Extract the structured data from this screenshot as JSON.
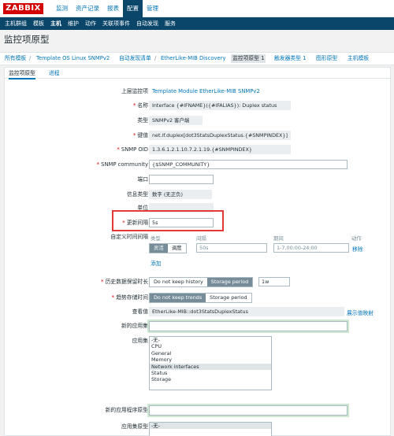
{
  "logo": "ZABBIX",
  "topnav": [
    "监测",
    "资产记录",
    "报表",
    "配置",
    "管理"
  ],
  "subnav": [
    "主机群组",
    "模板",
    "主机",
    "维护",
    "动作",
    "关联项事件",
    "自动发现",
    "服务"
  ],
  "page_title": "监控项原型",
  "breadcrumb": {
    "all_templates": "所有模板",
    "template": "Template OS Linux SNMPv2",
    "discovery_list": "自动发现清单",
    "discovery": "EtherLike-MIB Discovery",
    "item_prototypes": "监控项原型 1",
    "trigger_prototypes": "触发器类型 1",
    "graph_prototypes": "图形原型",
    "host_prototypes": "主机模板"
  },
  "tabs": {
    "item": "监控项原型",
    "process": "进程"
  },
  "form": {
    "parent_label": "上层监控项",
    "parent_value": "Template Module EtherLike-MIB SNMPv2",
    "name_label": "名称",
    "name_value": "Interface {#IFNAME}({#IFALIAS}): Duplex status",
    "type_label": "类型",
    "type_value": "SNMPv2 客户端",
    "key_label": "键值",
    "key_value": "net.if.duplex[dot3StatsDuplexStatus.{#SNMPINDEX}]",
    "oid_label": "SNMP OID",
    "oid_value": "1.3.6.1.2.1.10.7.2.1.19.{#SNMPINDEX}",
    "community_label": "SNMP community",
    "community_value": "{$SNMP_COMMUNITY}",
    "port_label": "端口",
    "port_value": "",
    "info_type_label": "信息类型",
    "info_type_value": "数字 (无正负)",
    "units_label": "单位",
    "units_value": "",
    "interval_label": "更新间隔",
    "interval_value": "5s",
    "custom_label": "自定义时间间隔",
    "custom_col_type": "类型",
    "custom_col_interval": "间隔",
    "custom_col_period": "期间",
    "custom_col_action": "动作",
    "flexible": "灵活",
    "scheduling": "调度",
    "custom_interval_ph": "50s",
    "custom_period_ph": "1-7,00:00-24:00",
    "remove": "移除",
    "add": "添加",
    "history_label": "历史数据保留时长",
    "no_history": "Do not keep history",
    "storage_period": "Storage period",
    "history_value": "1w",
    "trend_label": "趋势存储时间",
    "no_trends": "Do not keep trends",
    "trend_storage_period": "Storage period",
    "valuemap_label": "查看值",
    "valuemap_value": "EtherLike-MIB::dot3StatsDuplexStatus",
    "valuemap_link": "展示值映射",
    "new_app_label": "新的应用集",
    "apps_label": "应用集",
    "apps": [
      "-无-",
      "CPU",
      "General",
      "Memory",
      "Network interfaces",
      "Status",
      "Storage"
    ],
    "apps_selected": "Network interfaces",
    "new_app_proto_label": "新的应用程序原型",
    "app_proto_label": "应用集原型",
    "app_proto_value": "-无-"
  },
  "colors": {
    "brand": "#d40000",
    "nav": "#0a466a",
    "link": "#0275b8",
    "highlight": "#e53936"
  }
}
